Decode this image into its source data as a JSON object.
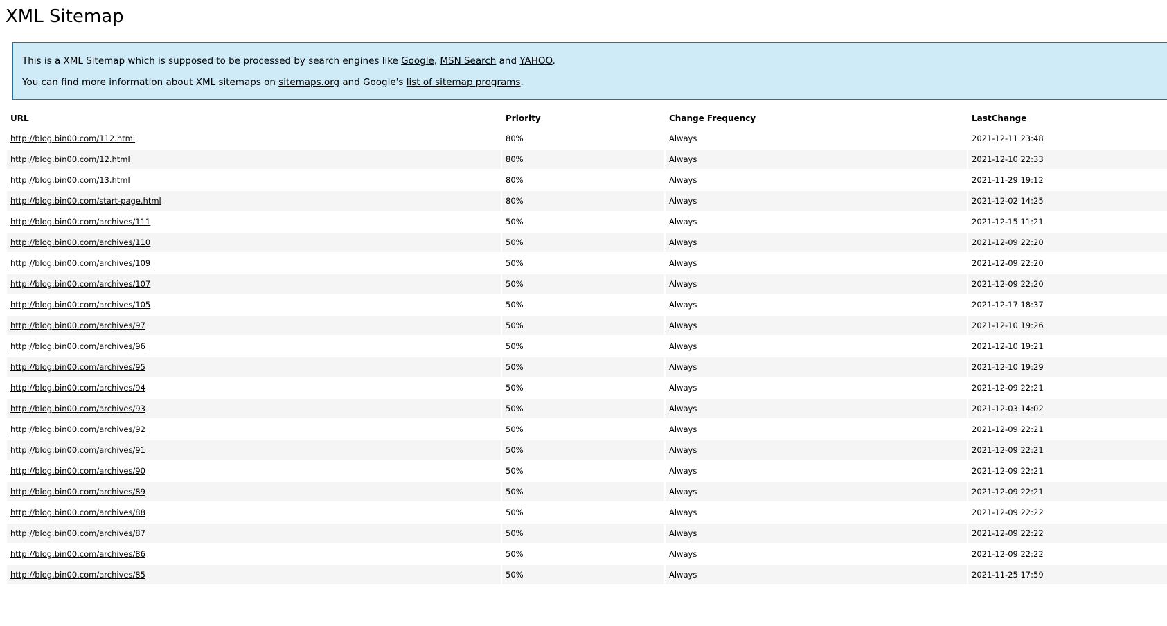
{
  "page": {
    "title": "XML Sitemap"
  },
  "intro": {
    "line1_prefix": "This is a XML Sitemap which is supposed to be processed by search engines like ",
    "link_google": "Google",
    "sep1": ", ",
    "link_msn": "MSN Search",
    "sep2": " and ",
    "link_yahoo": "YAHOO",
    "line1_suffix": ".",
    "line2_prefix": "You can find more information about XML sitemaps on ",
    "link_sitemaps": "sitemaps.org",
    "line2_mid": " and Google's ",
    "link_programs": "list of sitemap programs",
    "line2_suffix": "."
  },
  "table": {
    "headers": {
      "url": "URL",
      "priority": "Priority",
      "frequency": "Change Frequency",
      "lastchange": "LastChange"
    },
    "rows": [
      {
        "url": "http://blog.bin00.com/112.html",
        "priority": "80%",
        "frequency": "Always",
        "lastchange": "2021-12-11 23:48"
      },
      {
        "url": "http://blog.bin00.com/12.html",
        "priority": "80%",
        "frequency": "Always",
        "lastchange": "2021-12-10 22:33"
      },
      {
        "url": "http://blog.bin00.com/13.html",
        "priority": "80%",
        "frequency": "Always",
        "lastchange": "2021-11-29 19:12"
      },
      {
        "url": "http://blog.bin00.com/start-page.html",
        "priority": "80%",
        "frequency": "Always",
        "lastchange": "2021-12-02 14:25"
      },
      {
        "url": "http://blog.bin00.com/archives/111",
        "priority": "50%",
        "frequency": "Always",
        "lastchange": "2021-12-15 11:21"
      },
      {
        "url": "http://blog.bin00.com/archives/110",
        "priority": "50%",
        "frequency": "Always",
        "lastchange": "2021-12-09 22:20"
      },
      {
        "url": "http://blog.bin00.com/archives/109",
        "priority": "50%",
        "frequency": "Always",
        "lastchange": "2021-12-09 22:20"
      },
      {
        "url": "http://blog.bin00.com/archives/107",
        "priority": "50%",
        "frequency": "Always",
        "lastchange": "2021-12-09 22:20"
      },
      {
        "url": "http://blog.bin00.com/archives/105",
        "priority": "50%",
        "frequency": "Always",
        "lastchange": "2021-12-17 18:37"
      },
      {
        "url": "http://blog.bin00.com/archives/97",
        "priority": "50%",
        "frequency": "Always",
        "lastchange": "2021-12-10 19:26"
      },
      {
        "url": "http://blog.bin00.com/archives/96",
        "priority": "50%",
        "frequency": "Always",
        "lastchange": "2021-12-10 19:21"
      },
      {
        "url": "http://blog.bin00.com/archives/95",
        "priority": "50%",
        "frequency": "Always",
        "lastchange": "2021-12-10 19:29"
      },
      {
        "url": "http://blog.bin00.com/archives/94",
        "priority": "50%",
        "frequency": "Always",
        "lastchange": "2021-12-09 22:21"
      },
      {
        "url": "http://blog.bin00.com/archives/93",
        "priority": "50%",
        "frequency": "Always",
        "lastchange": "2021-12-03 14:02"
      },
      {
        "url": "http://blog.bin00.com/archives/92",
        "priority": "50%",
        "frequency": "Always",
        "lastchange": "2021-12-09 22:21"
      },
      {
        "url": "http://blog.bin00.com/archives/91",
        "priority": "50%",
        "frequency": "Always",
        "lastchange": "2021-12-09 22:21"
      },
      {
        "url": "http://blog.bin00.com/archives/90",
        "priority": "50%",
        "frequency": "Always",
        "lastchange": "2021-12-09 22:21"
      },
      {
        "url": "http://blog.bin00.com/archives/89",
        "priority": "50%",
        "frequency": "Always",
        "lastchange": "2021-12-09 22:21"
      },
      {
        "url": "http://blog.bin00.com/archives/88",
        "priority": "50%",
        "frequency": "Always",
        "lastchange": "2021-12-09 22:22"
      },
      {
        "url": "http://blog.bin00.com/archives/87",
        "priority": "50%",
        "frequency": "Always",
        "lastchange": "2021-12-09 22:22"
      },
      {
        "url": "http://blog.bin00.com/archives/86",
        "priority": "50%",
        "frequency": "Always",
        "lastchange": "2021-12-09 22:22"
      },
      {
        "url": "http://blog.bin00.com/archives/85",
        "priority": "50%",
        "frequency": "Always",
        "lastchange": "2021-11-25 17:59"
      }
    ]
  }
}
